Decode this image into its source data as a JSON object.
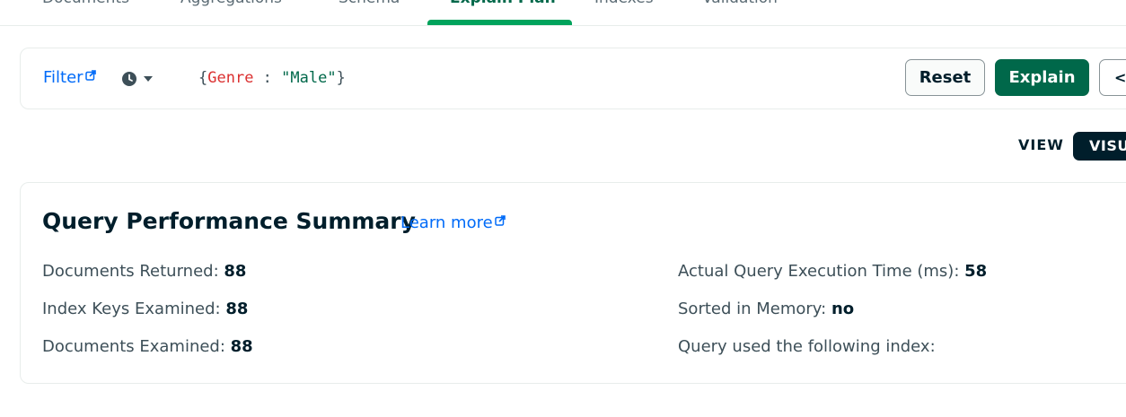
{
  "tabs": [
    {
      "label": "Documents"
    },
    {
      "label": "Aggregations"
    },
    {
      "label": "Schema"
    },
    {
      "label": "Explain Plan",
      "active": true
    },
    {
      "label": "Indexes"
    },
    {
      "label": "Validation"
    }
  ],
  "filter": {
    "label": "Filter",
    "query_open": "{",
    "query_key": "Genre",
    "query_sep": " : ",
    "query_value": "\"Male\"",
    "query_close": "}",
    "reset_label": "Reset",
    "explain_label": "Explain",
    "code_label": "</"
  },
  "view": {
    "label": "VIEW",
    "selected": "VISU"
  },
  "summary": {
    "title": "Query Performance Summary",
    "learn_more": "Learn more",
    "docs_returned_label": "Documents Returned:",
    "docs_returned_value": "88",
    "index_keys_label": "Index Keys Examined:",
    "index_keys_value": "88",
    "docs_examined_label": "Documents Examined:",
    "docs_examined_value": "88",
    "exec_time_label": "Actual Query Execution Time (ms):",
    "exec_time_value": "58",
    "sorted_label": "Sorted in Memory:",
    "sorted_value": "no",
    "index_used_label": "Query used the following index:"
  },
  "colors": {
    "accent_green": "#00684a",
    "link_blue": "#016bf8",
    "dark": "#001e2b"
  }
}
